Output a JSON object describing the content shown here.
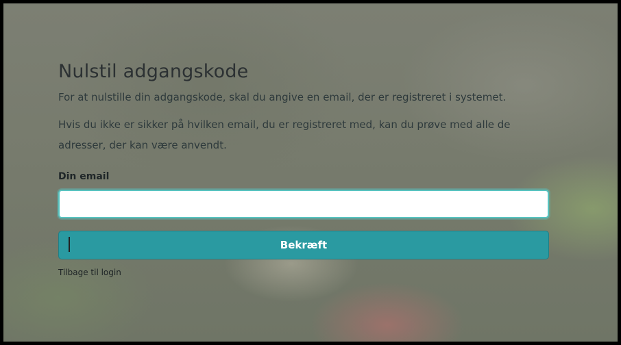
{
  "page": {
    "title": "Nulstil adgangskode",
    "intro_text": "For at nulstille din adgangskode, skal du angive en email, der er registreret i systemet.",
    "hint_text": "Hvis du ikke er sikker på hvilken email, du er registreret med, kan du prøve med alle de adresser, der kan være anvendt."
  },
  "form": {
    "email_label": "Din email",
    "email_value": "",
    "email_placeholder": "",
    "submit_label": "Bekræft",
    "back_link_label": "Tilbage til login"
  },
  "colors": {
    "accent": "#2a9aa1",
    "input_focus_border": "#58c3c0"
  }
}
